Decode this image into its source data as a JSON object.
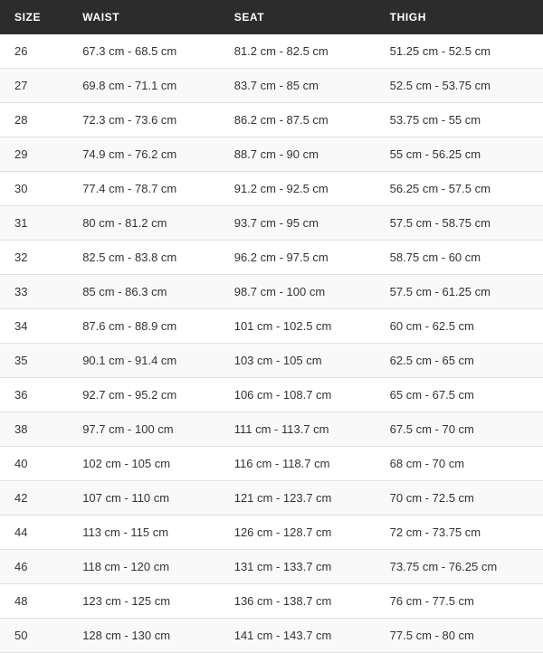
{
  "table": {
    "headers": [
      "SIZE",
      "WAIST",
      "SEAT",
      "THIGH"
    ],
    "rows": [
      {
        "size": "26",
        "waist": "67.3 cm - 68.5 cm",
        "seat": "81.2 cm - 82.5 cm",
        "thigh": "51.25 cm - 52.5 cm"
      },
      {
        "size": "27",
        "waist": "69.8 cm - 71.1 cm",
        "seat": "83.7 cm - 85 cm",
        "thigh": "52.5 cm - 53.75 cm"
      },
      {
        "size": "28",
        "waist": "72.3 cm - 73.6 cm",
        "seat": "86.2 cm - 87.5 cm",
        "thigh": "53.75 cm - 55 cm"
      },
      {
        "size": "29",
        "waist": "74.9 cm - 76.2 cm",
        "seat": "88.7 cm - 90 cm",
        "thigh": "55 cm - 56.25 cm"
      },
      {
        "size": "30",
        "waist": "77.4 cm - 78.7 cm",
        "seat": "91.2 cm - 92.5 cm",
        "thigh": "56.25 cm - 57.5 cm"
      },
      {
        "size": "31",
        "waist": "80 cm - 81.2 cm",
        "seat": "93.7 cm - 95 cm",
        "thigh": "57.5 cm - 58.75 cm"
      },
      {
        "size": "32",
        "waist": "82.5 cm - 83.8 cm",
        "seat": "96.2 cm - 97.5 cm",
        "thigh": "58.75 cm - 60 cm"
      },
      {
        "size": "33",
        "waist": "85 cm - 86.3 cm",
        "seat": "98.7 cm - 100 cm",
        "thigh": "57.5 cm - 61.25 cm"
      },
      {
        "size": "34",
        "waist": "87.6 cm - 88.9 cm",
        "seat": "101 cm - 102.5 cm",
        "thigh": "60 cm - 62.5 cm"
      },
      {
        "size": "35",
        "waist": "90.1 cm - 91.4 cm",
        "seat": "103 cm - 105 cm",
        "thigh": "62.5 cm - 65 cm"
      },
      {
        "size": "36",
        "waist": "92.7 cm - 95.2 cm",
        "seat": "106 cm - 108.7 cm",
        "thigh": "65 cm - 67.5 cm"
      },
      {
        "size": "38",
        "waist": "97.7 cm - 100 cm",
        "seat": "111 cm - 113.7 cm",
        "thigh": "67.5 cm - 70 cm"
      },
      {
        "size": "40",
        "waist": "102 cm - 105 cm",
        "seat": "116 cm - 118.7 cm",
        "thigh": "68 cm - 70 cm"
      },
      {
        "size": "42",
        "waist": "107 cm - 110 cm",
        "seat": "121 cm - 123.7 cm",
        "thigh": "70 cm - 72.5 cm"
      },
      {
        "size": "44",
        "waist": "113 cm - 115 cm",
        "seat": "126 cm - 128.7 cm",
        "thigh": "72 cm - 73.75 cm"
      },
      {
        "size": "46",
        "waist": "118 cm - 120 cm",
        "seat": "131 cm - 133.7 cm",
        "thigh": "73.75 cm - 76.25 cm"
      },
      {
        "size": "48",
        "waist": "123 cm - 125 cm",
        "seat": "136 cm - 138.7 cm",
        "thigh": "76 cm - 77.5 cm"
      },
      {
        "size": "50",
        "waist": "128 cm - 130 cm",
        "seat": "141 cm - 143.7 cm",
        "thigh": "77.5 cm - 80 cm"
      }
    ]
  }
}
